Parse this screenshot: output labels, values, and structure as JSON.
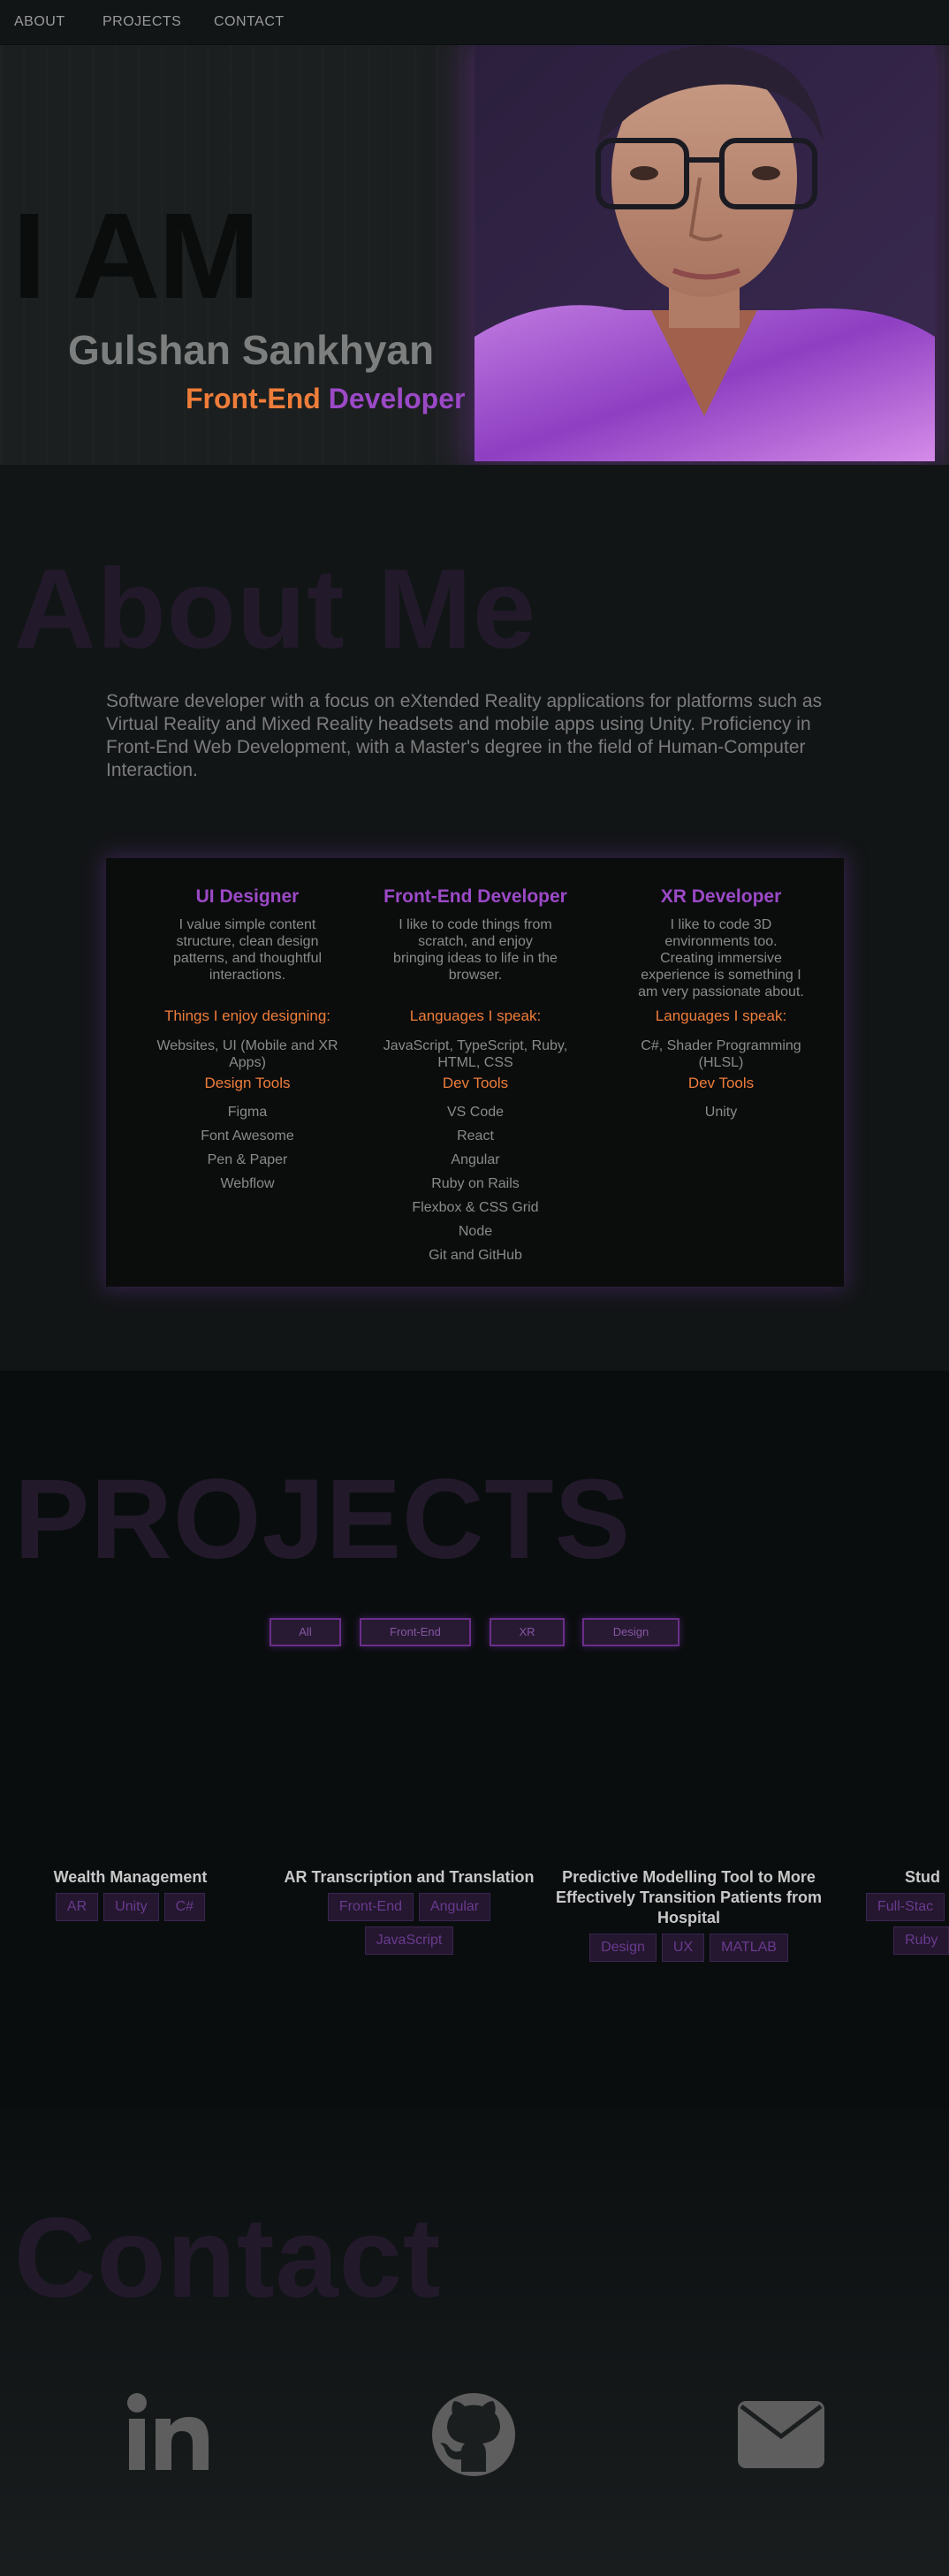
{
  "nav": {
    "about": "ABOUT",
    "projects": "PROJECTS",
    "contact": "CONTACT"
  },
  "hero": {
    "iam": "I AM",
    "name": "Gulshan Sankhyan",
    "role_part1": "Front-End",
    "role_part2": "Developer"
  },
  "about": {
    "title": "About Me",
    "text": "Software developer with a focus on eXtended Reality applications for platforms such as Virtual Reality and Mixed Reality headsets and mobile apps using Unity. Proficiency in Front-End Web Development, with a Master's degree in the field of Human-Computer Interaction.",
    "columns": [
      {
        "title": "UI Designer",
        "desc": "I value simple content structure, clean design patterns, and thoughtful interactions.",
        "subheading": "Things I enjoy designing:",
        "subtext": "Websites, UI (Mobile and XR Apps)",
        "tools_heading": "Design Tools",
        "tools": [
          "Figma",
          "Font Awesome",
          "Pen & Paper",
          "Webflow"
        ]
      },
      {
        "title": "Front-End Developer",
        "desc": "I like to code things from scratch, and enjoy bringing ideas to life in the browser.",
        "subheading": "Languages I speak:",
        "subtext": "JavaScript, TypeScript, Ruby, HTML, CSS",
        "tools_heading": "Dev Tools",
        "tools": [
          "VS Code",
          "React",
          "Angular",
          "Ruby on Rails",
          "Flexbox & CSS Grid",
          "Node",
          "Git and GitHub"
        ]
      },
      {
        "title": "XR Developer",
        "desc": "I like to code 3D environments too. Creating immersive experience is something I am very passionate about.",
        "subheading": "Languages I speak:",
        "subtext": "C#, Shader Programming (HLSL)",
        "tools_heading": "Dev Tools",
        "tools": [
          "Unity"
        ]
      }
    ]
  },
  "projects": {
    "title": "PROJECTS",
    "filters": [
      "All",
      "Front-End",
      "XR",
      "Design"
    ],
    "items": [
      {
        "title": "Wealth Management",
        "tags": [
          "AR",
          "Unity",
          "C#"
        ]
      },
      {
        "title": "AR Transcription and Translation",
        "tags": [
          "Front-End",
          "Angular",
          "JavaScript"
        ]
      },
      {
        "title": "Predictive Modelling Tool to More Effectively Transition Patients from Hospital",
        "tags": [
          "Design",
          "UX",
          "MATLAB"
        ]
      },
      {
        "title": "Stud",
        "tags": [
          "Full-Stac",
          "Ruby"
        ]
      }
    ]
  },
  "contact": {
    "title": "Contact",
    "icons": [
      "linkedin-icon",
      "github-icon",
      "email-icon"
    ]
  },
  "colors": {
    "accent_orange": "#ef7d3a",
    "accent_purple": "#9c49c7",
    "background": "#121516"
  }
}
